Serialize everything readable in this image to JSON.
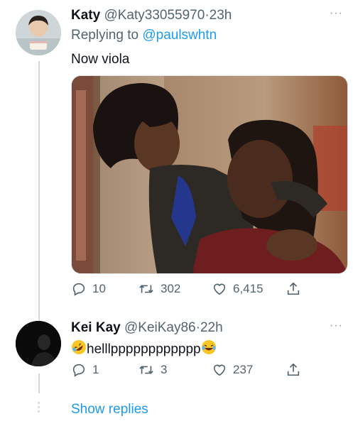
{
  "tweet1": {
    "display_name": "Katy",
    "handle": "@Katy33055970",
    "sep": "·",
    "time": "23h",
    "replying_prefix": "Replying to ",
    "replying_handle": "@paulswhtn",
    "text": "Now viola",
    "more": "···",
    "actions": {
      "reply": "10",
      "retweet": "302",
      "like": "6,415"
    }
  },
  "tweet2": {
    "display_name": "Kei Kay",
    "handle": "@KeiKay86",
    "sep": "·",
    "time": "22h",
    "text": "helllpppppppppppp",
    "emoji_before": "rolling-on-floor-laughing",
    "emoji_after": "face-with-tears-of-joy",
    "more": "···",
    "actions": {
      "reply": "1",
      "retweet": "3",
      "like": "237"
    }
  },
  "show_replies": "Show replies",
  "colors": {
    "link": "#1d9bf0",
    "muted": "#536471",
    "line": "#cfd9de"
  },
  "icons": [
    "reply-icon",
    "retweet-icon",
    "like-icon",
    "share-icon",
    "more-icon"
  ]
}
